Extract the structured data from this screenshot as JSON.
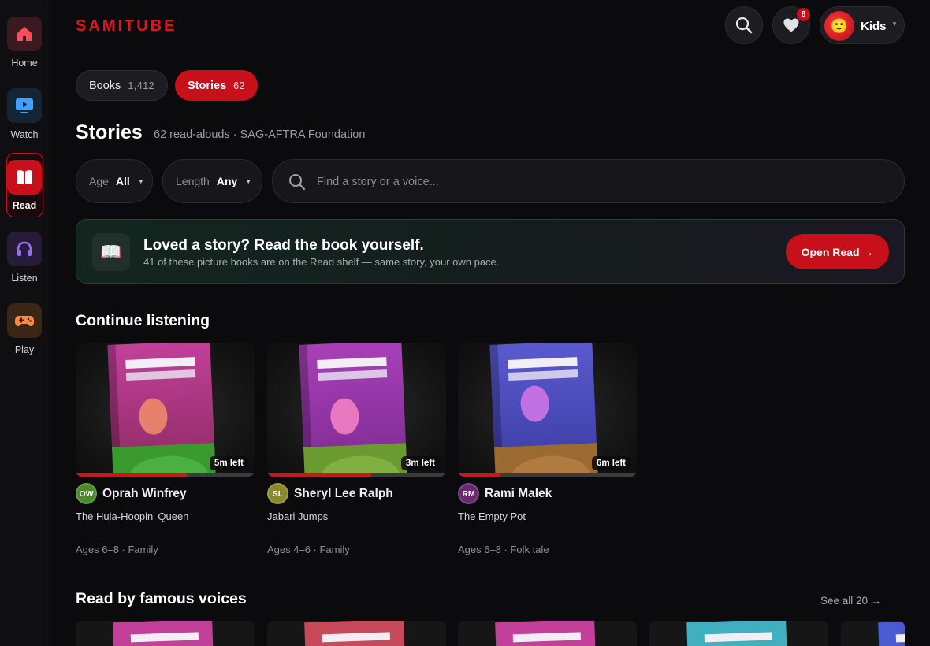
{
  "brand": {
    "logo_text": "SAMITUBE",
    "accent": "#c8101a"
  },
  "sidebar": {
    "items": [
      {
        "label": "Home",
        "icon": "home-icon",
        "tile_color": "#3a1a20",
        "icon_color": "#ff4b5e"
      },
      {
        "label": "Watch",
        "icon": "tv-icon",
        "tile_color": "#142536",
        "icon_color": "#3fa0ff"
      },
      {
        "label": "Read",
        "icon": "book-icon",
        "tile_color": "#c8101a",
        "icon_color": "#ffffff",
        "active": true
      },
      {
        "label": "Listen",
        "icon": "headphones-icon",
        "tile_color": "#261c3a",
        "icon_color": "#9a6bff"
      },
      {
        "label": "Play",
        "icon": "gamepad-icon",
        "tile_color": "#3a2616",
        "icon_color": "#ff8a3d"
      }
    ]
  },
  "header": {
    "favorites_count": "8",
    "profile_name": "Kids",
    "profile_emoji": "🙂"
  },
  "tabs": [
    {
      "label": "Books",
      "count": "1,412"
    },
    {
      "label": "Stories",
      "count": "62",
      "active": true
    }
  ],
  "page": {
    "title": "Stories",
    "subtitle": "62 read-alouds · SAG-AFTRA Foundation"
  },
  "filters": {
    "age": {
      "label": "Age",
      "value": "All"
    },
    "length": {
      "label": "Length",
      "value": "Any"
    },
    "search_placeholder": "Find a story or a voice..."
  },
  "promo": {
    "icon": "📖",
    "title": "Loved a story? Read the book yourself.",
    "subtitle": "41 of these picture books are on the Read shelf — same story, your own pace.",
    "button_label": "Open Read →"
  },
  "continue_listening": {
    "title": "Continue listening",
    "items": [
      {
        "voice": "Oprah Winfrey",
        "initials": "OW",
        "avatar_color": "#4a8a2a",
        "title": "The Hula-Hoopin' Queen",
        "meta": "Ages 6–8 · Family",
        "time_left": "5m left",
        "progress": 0.62,
        "cover": {
          "top": "#c2409a",
          "bottom": "#8a2a60",
          "face": "#e8806e",
          "ground": "#3a9a30",
          "hill": "#4ab040"
        }
      },
      {
        "voice": "Sheryl Lee Ralph",
        "initials": "SL",
        "avatar_color": "#8a8a2a",
        "title": "Jabari Jumps",
        "meta": "Ages 4–6 · Family",
        "time_left": "3m left",
        "progress": 0.58,
        "cover": {
          "top": "#a840b8",
          "bottom": "#7a2a90",
          "face": "#e878c0",
          "ground": "#6a9a30",
          "hill": "#80b040"
        }
      },
      {
        "voice": "Rami Malek",
        "initials": "RM",
        "avatar_color": "#6a2a70",
        "title": "The Empty Pot",
        "meta": "Ages 6–8 · Folk tale",
        "time_left": "6m left",
        "progress": 0.24,
        "cover": {
          "top": "#5a5ad0",
          "bottom": "#3a3aa0",
          "face": "#c070e0",
          "ground": "#9a6a30",
          "hill": "#b07a40"
        }
      }
    ]
  },
  "famous_voices": {
    "title": "Read by famous voices",
    "see_all_label": "See all 20 →",
    "covers": [
      "#c2409a",
      "#c84a5a",
      "#c2409a",
      "#40b0c0",
      "#4a5ad0"
    ]
  }
}
